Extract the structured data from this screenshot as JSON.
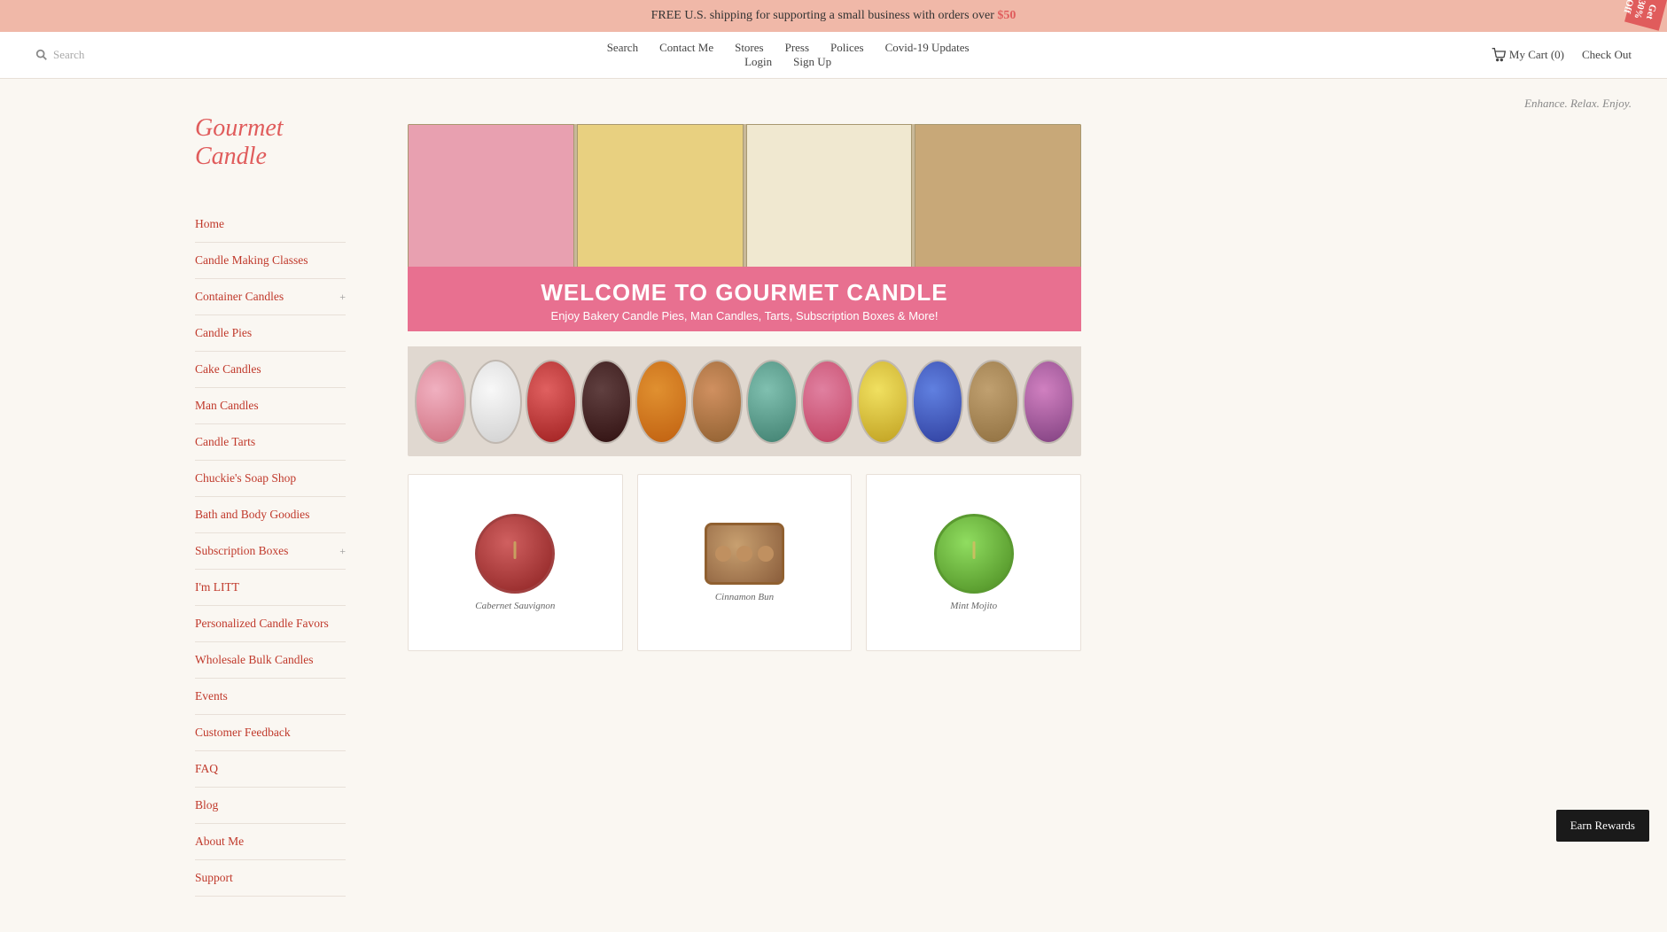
{
  "announcement": {
    "text": "FREE U.S. shipping for supporting a small business with orders over ",
    "price": "$50",
    "badge": "Get 30% Off"
  },
  "header": {
    "search_placeholder": "Search",
    "nav_row1": [
      "Search",
      "Contact Me",
      "Stores",
      "Press",
      "Polices",
      "Covid-19 Updates"
    ],
    "nav_row2": [
      "Login",
      "Sign Up"
    ],
    "cart_label": "My Cart (0)",
    "checkout_label": "Check Out"
  },
  "sidebar": {
    "site_title": "Gourmet Candle",
    "tagline": "Enhance. Relax. Enjoy.",
    "nav_items": [
      {
        "label": "Home",
        "has_arrow": false
      },
      {
        "label": "Candle Making Classes",
        "has_arrow": false
      },
      {
        "label": "Container Candles",
        "has_arrow": true
      },
      {
        "label": "Candle Pies",
        "has_arrow": false
      },
      {
        "label": "Cake Candles",
        "has_arrow": false
      },
      {
        "label": "Man Candles",
        "has_arrow": false
      },
      {
        "label": "Candle Tarts",
        "has_arrow": false
      },
      {
        "label": "Chuckie's Soap Shop",
        "has_arrow": false
      },
      {
        "label": "Bath and Body Goodies",
        "has_arrow": false
      },
      {
        "label": "Subscription Boxes",
        "has_arrow": true
      },
      {
        "label": "I'm LITT",
        "has_arrow": false
      },
      {
        "label": "Personalized Candle Favors",
        "has_arrow": false
      },
      {
        "label": "Wholesale Bulk Candles",
        "has_arrow": false
      },
      {
        "label": "Events",
        "has_arrow": false
      },
      {
        "label": "Customer Feedback",
        "has_arrow": false
      },
      {
        "label": "FAQ",
        "has_arrow": false
      },
      {
        "label": "Blog",
        "has_arrow": false
      },
      {
        "label": "About Me",
        "has_arrow": false
      },
      {
        "label": "Support",
        "has_arrow": false
      }
    ]
  },
  "hero": {
    "title": "WELCOME TO GOURMET CANDLE",
    "subtitle": "Enjoy Bakery Candle Pies, Man Candles, Tarts, Subscription Boxes & More!"
  },
  "products": [
    {
      "name": "Cabernet Sauvignon",
      "color": "red"
    },
    {
      "name": "Cinnamon Bun",
      "color": "brown"
    },
    {
      "name": "Mint Mojito",
      "color": "green"
    }
  ],
  "earn_rewards": {
    "label": "Earn Rewards"
  }
}
